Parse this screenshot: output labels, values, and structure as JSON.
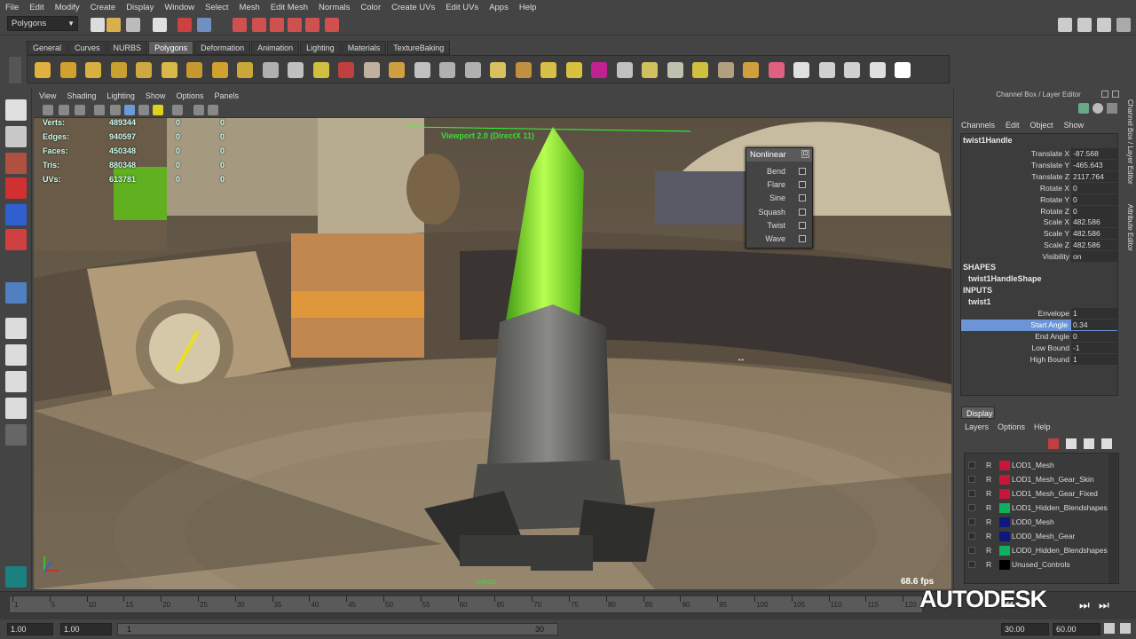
{
  "menubar": [
    "File",
    "Edit",
    "Modify",
    "Create",
    "Display",
    "Window",
    "Select",
    "Mesh",
    "Edit Mesh",
    "Normals",
    "Color",
    "Create UVs",
    "Edit UVs",
    "Apps",
    "Help"
  ],
  "status": {
    "mode": "Polygons"
  },
  "shelf_tabs": [
    "General",
    "Curves",
    "NURBS",
    "Polygons",
    "Deformation",
    "Animation",
    "Lighting",
    "Materials",
    "TextureBaking"
  ],
  "viewport_menu": [
    "View",
    "Shading",
    "Lighting",
    "Show",
    "Options",
    "Panels"
  ],
  "hud": {
    "rows": [
      {
        "label": "Verts:",
        "value": "489344",
        "z1": "0",
        "z2": "0"
      },
      {
        "label": "Edges:",
        "value": "940597",
        "z1": "0",
        "z2": "0"
      },
      {
        "label": "Faces:",
        "value": "450348",
        "z1": "0",
        "z2": "0"
      },
      {
        "label": "Tris:",
        "value": "880348",
        "z1": "0",
        "z2": "0"
      },
      {
        "label": "UVs:",
        "value": "613781",
        "z1": "0",
        "z2": "0"
      }
    ],
    "viewport_title": "Viewport 2.0 (DirectX 11)",
    "camera": "persp",
    "fps": "68.6 fps"
  },
  "nonlinear": {
    "title": "Nonlinear",
    "items": [
      "Bend",
      "Flare",
      "Sine",
      "Squash",
      "Twist",
      "Wave"
    ]
  },
  "channel_box": {
    "header": "Channel Box / Layer Editor",
    "menu": [
      "Channels",
      "Edit",
      "Object",
      "Show"
    ],
    "node": "twist1Handle",
    "attrs": [
      {
        "name": "Translate X",
        "value": "-87.568"
      },
      {
        "name": "Translate Y",
        "value": "-465.643"
      },
      {
        "name": "Translate Z",
        "value": "2117.764"
      },
      {
        "name": "Rotate X",
        "value": "0"
      },
      {
        "name": "Rotate Y",
        "value": "0"
      },
      {
        "name": "Rotate Z",
        "value": "0"
      },
      {
        "name": "Scale X",
        "value": "482.586"
      },
      {
        "name": "Scale Y",
        "value": "482.586"
      },
      {
        "name": "Scale Z",
        "value": "482.586"
      },
      {
        "name": "Visibility",
        "value": "on"
      }
    ],
    "shapes_label": "SHAPES",
    "shape_node": "twist1HandleShape",
    "inputs_label": "INPUTS",
    "input_node": "twist1",
    "input_attrs": [
      {
        "name": "Envelope",
        "value": "1"
      },
      {
        "name": "Start Angle",
        "value": "0.34"
      },
      {
        "name": "End Angle",
        "value": "0"
      },
      {
        "name": "Low Bound",
        "value": "-1"
      },
      {
        "name": "High Bound",
        "value": "1"
      }
    ]
  },
  "side_tabs": [
    "Channel Box / Layer Editor",
    "Attribute Editor"
  ],
  "layer_editor": {
    "tab": "Display",
    "menu": [
      "Layers",
      "Options",
      "Help"
    ],
    "layers": [
      {
        "r": "R",
        "color": "#c8153a",
        "name": "LOD1_Mesh"
      },
      {
        "r": "R",
        "color": "#c8153a",
        "name": "LOD1_Mesh_Gear_Skin"
      },
      {
        "r": "R",
        "color": "#c8153a",
        "name": "LOD1_Mesh_Gear_Fixed"
      },
      {
        "r": "R",
        "color": "#10b060",
        "name": "LOD1_Hidden_Blendshapes"
      },
      {
        "r": "R",
        "color": "#101880",
        "name": "LOD0_Mesh"
      },
      {
        "r": "R",
        "color": "#101880",
        "name": "LOD0_Mesh_Gear"
      },
      {
        "r": "R",
        "color": "#10b060",
        "name": "LOD0_Hidden_Blendshapes"
      },
      {
        "r": "R",
        "color": "#000000",
        "name": "Unused_Controls"
      }
    ]
  },
  "timeline": {
    "ticks": [
      "1",
      "5",
      "10",
      "15",
      "20",
      "25",
      "30",
      "35",
      "40",
      "45",
      "50",
      "55",
      "60",
      "65",
      "70",
      "75",
      "80",
      "85",
      "90",
      "95",
      "100",
      "105",
      "110",
      "115",
      "120",
      "125"
    ],
    "start": "1.00",
    "current": "1.00",
    "range_start": "1",
    "range_end": "30",
    "end": "30.00",
    "anim_end": "60.00"
  },
  "watermark": "AUTODESK"
}
